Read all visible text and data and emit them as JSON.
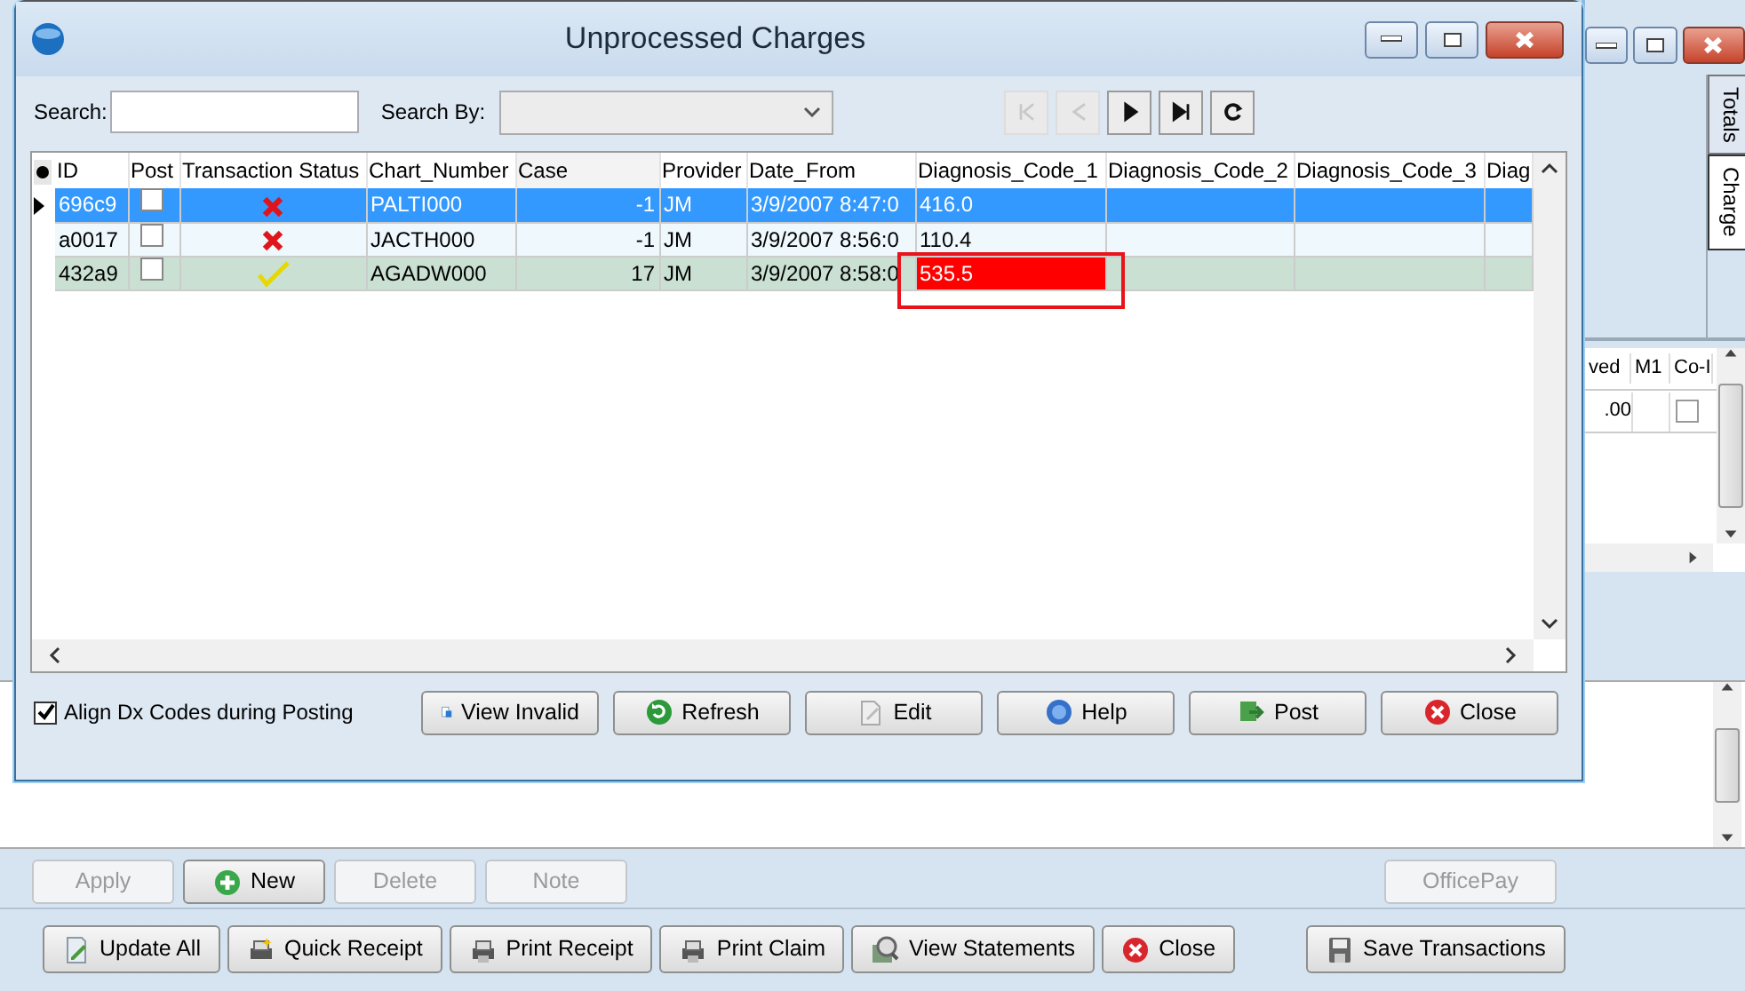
{
  "background_window": {
    "side_tabs": [
      {
        "label": "Totals",
        "selected": false
      },
      {
        "label": "Charge",
        "selected": true
      }
    ],
    "grid": {
      "columns": [
        "ved",
        "M1",
        "Co-I"
      ],
      "rows": [
        {
          "amount": ".00",
          "co_checked": false
        }
      ]
    },
    "action_buttons": [
      {
        "label": "Apply",
        "disabled": true
      },
      {
        "label": "New",
        "disabled": false
      },
      {
        "label": "Delete",
        "disabled": true
      },
      {
        "label": "Note",
        "disabled": true
      }
    ],
    "officepay": {
      "label": "OfficePay",
      "disabled": true
    },
    "bottom_buttons": [
      {
        "label": "Update All"
      },
      {
        "label": "Quick Receipt"
      },
      {
        "label": "Print Receipt"
      },
      {
        "label": "Print Claim"
      },
      {
        "label": "View Statements"
      },
      {
        "label": "Close"
      },
      {
        "label": "Save Transactions"
      }
    ]
  },
  "dialog": {
    "title": "Unprocessed Charges",
    "search": {
      "label": "Search:"
    },
    "search_by": {
      "label": "Search By:"
    },
    "nav_buttons": [
      {
        "disabled": true
      },
      {
        "disabled": true
      },
      {
        "disabled": false
      },
      {
        "disabled": false
      },
      {
        "disabled": false
      }
    ],
    "table": {
      "columns": [
        "ID",
        "Post",
        "Transaction Status",
        "Chart_Number",
        "Case",
        "Provider",
        "Date_From",
        "Diagnosis_Code_1",
        "Diagnosis_Code_2",
        "Diagnosis_Code_3",
        "Diag"
      ],
      "rows": [
        {
          "selected": true,
          "current": true,
          "id": "696c9",
          "post": false,
          "valid": false,
          "chart_number": "PALTI000",
          "case": "-1",
          "provider": "JM",
          "date_from": "3/9/2007 8:47:0",
          "diagnosis_code_1": "416.0",
          "dx1_invalid": false
        },
        {
          "selected": false,
          "current": false,
          "id": "a0017",
          "post": false,
          "valid": false,
          "chart_number": "JACTH000",
          "case": "-1",
          "provider": "JM",
          "date_from": "3/9/2007 8:56:0",
          "diagnosis_code_1": "110.4",
          "dx1_invalid": false
        },
        {
          "selected": false,
          "current": false,
          "id": "432a9",
          "post": false,
          "valid": true,
          "chart_number": "AGADW000",
          "case": "17",
          "provider": "JM",
          "date_from": "3/9/2007 8:58:0",
          "diagnosis_code_1": "535.5",
          "dx1_invalid": true
        }
      ]
    },
    "annotation_box": true,
    "align_checkbox": {
      "label": "Align Dx Codes during Posting",
      "checked": true
    },
    "buttons": [
      {
        "label": "View Invalid"
      },
      {
        "label": "Refresh"
      },
      {
        "label": "Edit"
      },
      {
        "label": "Help"
      },
      {
        "label": "Post"
      },
      {
        "label": "Close"
      }
    ]
  }
}
